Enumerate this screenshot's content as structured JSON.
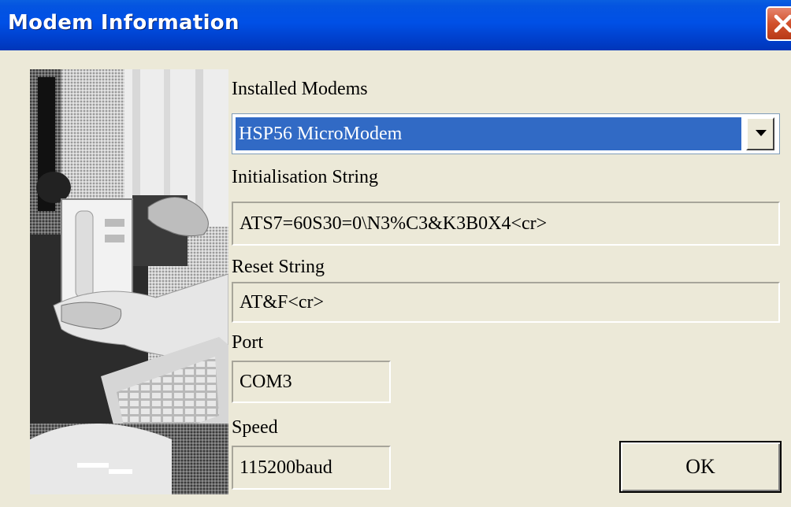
{
  "window": {
    "title": "Modem Information",
    "close_icon": "close-icon",
    "close_color": "#D2512C"
  },
  "installed_modems": {
    "label": "Installed Modems",
    "selected": "HSP56 MicroModem",
    "dropdown_icon": "chevron-down-icon",
    "highlight_color": "#316AC5"
  },
  "initialisation": {
    "label": "Initialisation String",
    "value": "ATS7=60S30=0\\N3%C3&K3B0X4<cr>"
  },
  "reset": {
    "label": "Reset String",
    "value": "AT&F<cr>"
  },
  "port": {
    "label": "Port",
    "value": "COM3"
  },
  "speed": {
    "label": "Speed",
    "value": "115200baud"
  },
  "ok_button": {
    "label": "OK"
  },
  "colors": {
    "titlebar": "#0050E6",
    "dialog_bg": "#ECE9D8"
  }
}
